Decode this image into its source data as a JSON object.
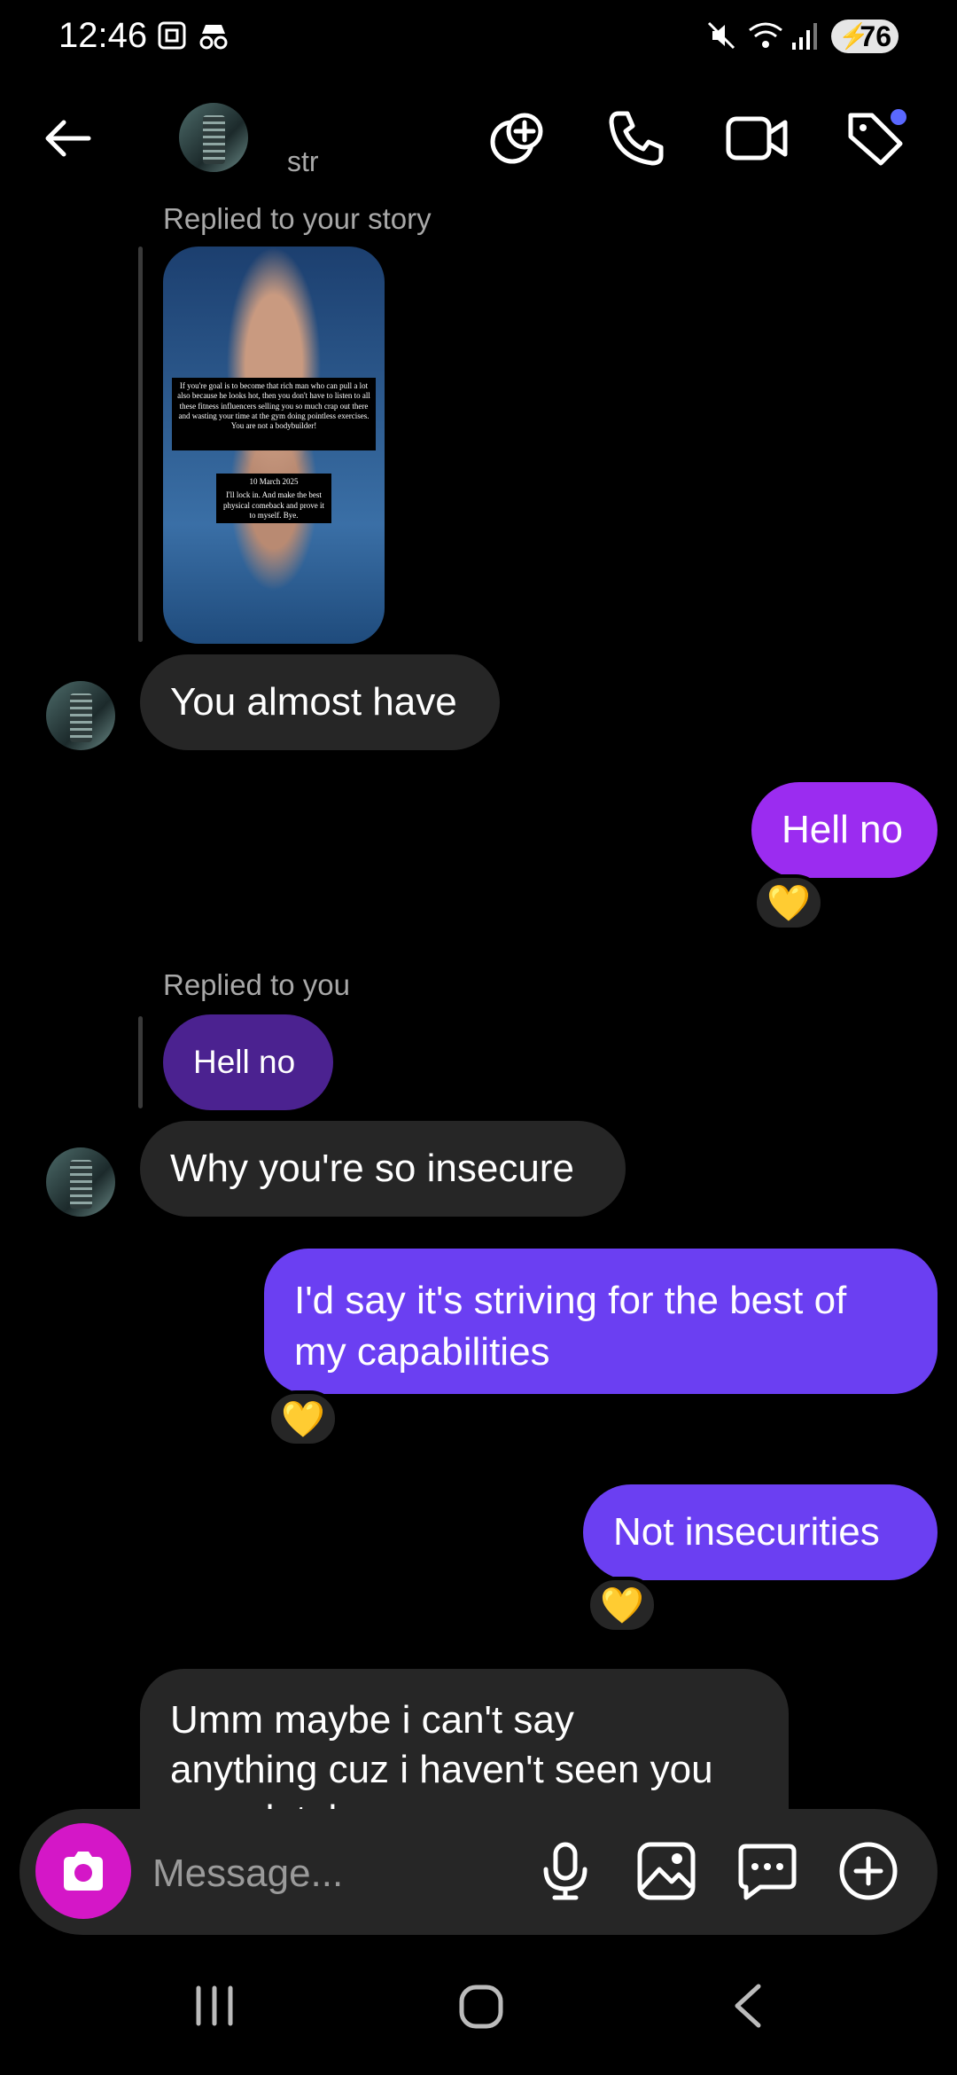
{
  "status_bar": {
    "time": "12:46",
    "battery": "76"
  },
  "header": {
    "contact_name": "str"
  },
  "messages": {
    "story_reply_label": "Replied to your story",
    "story_text_1": "If you're goal is to become that rich man who can pull a lot also because he looks hot, then you don't have to listen to all these fitness influencers selling you so much crap out there and wasting your time at the gym doing pointless exercises. You are not a bodybuilder!",
    "story_date": "10 March 2025",
    "story_text_2": "I'll lock in. And make the best physical comeback and prove it to myself. Bye.",
    "m1": "You almost have",
    "m2": "Hell no",
    "m2_reaction": "💛",
    "reply_label_2": "Replied to you",
    "quoted": "Hell no",
    "m3": "Why you're so insecure",
    "m4_line1": "I'd say it's striving for the best of",
    "m4_line2": "my capabilities",
    "m4_reaction": "💛",
    "m5": "Not insecurities",
    "m5_reaction": "💛",
    "m6_line1": "Umm maybe i can't say",
    "m6_line2": "anything cuz i haven't seen you",
    "m6_line3": "completely"
  },
  "composer": {
    "placeholder": "Message..."
  },
  "colors": {
    "outgoing_purple": "#9b2cf0",
    "outgoing_violet": "#6b3ff2",
    "quoted_bubble": "#4b2290",
    "camera": "#d417c7",
    "incoming": "#262626"
  },
  "icons": [
    "back-arrow-icon",
    "add-people-icon",
    "phone-icon",
    "video-icon",
    "tag-icon",
    "mic-icon",
    "gallery-icon",
    "sticker-icon",
    "plus-icon",
    "camera-icon"
  ]
}
